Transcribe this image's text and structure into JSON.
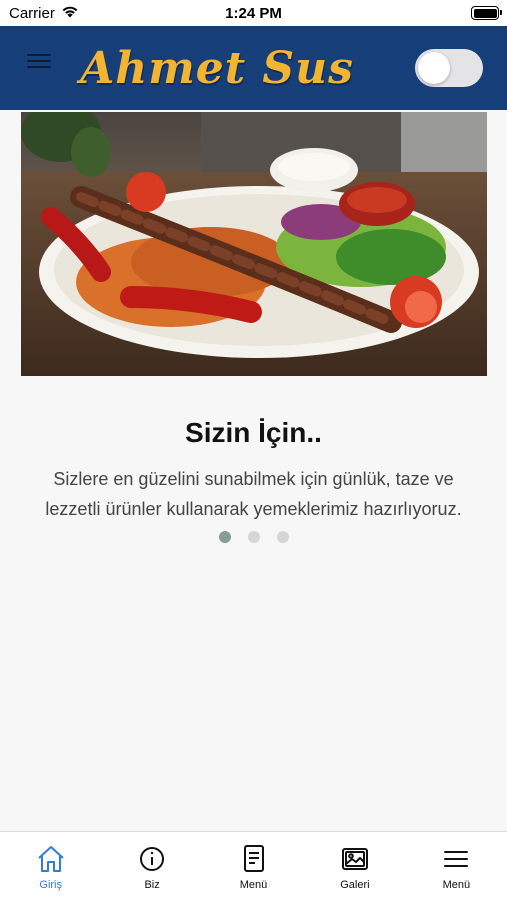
{
  "status_bar": {
    "carrier": "Carrier",
    "time": "1:24 PM"
  },
  "header": {
    "logo_text": "Ahmet Sus",
    "dark_mode_toggle_on": false
  },
  "slide": {
    "title": "Sizin İçin..",
    "text": "Sizlere en güzelini sunabilmek için günlük, taze ve lezzetli ürünler kullanarak yemeklerimiz hazırlıyoruz.",
    "image_description_icon": "food-plate-image",
    "current_index": 1,
    "total": 3
  },
  "tabs": [
    {
      "label": "Giriş",
      "icon": "home-icon",
      "active": true
    },
    {
      "label": "Biz",
      "icon": "info-icon",
      "active": false
    },
    {
      "label": "Menü",
      "icon": "document-icon",
      "active": false
    },
    {
      "label": "Galeri",
      "icon": "gallery-icon",
      "active": false
    },
    {
      "label": "Menü",
      "icon": "hamburger-menu-icon",
      "active": false
    }
  ],
  "colors": {
    "header": "#163f7a",
    "logo": "#f3b531",
    "active_tab": "#2f7be0",
    "background": "#f7f7f7"
  }
}
